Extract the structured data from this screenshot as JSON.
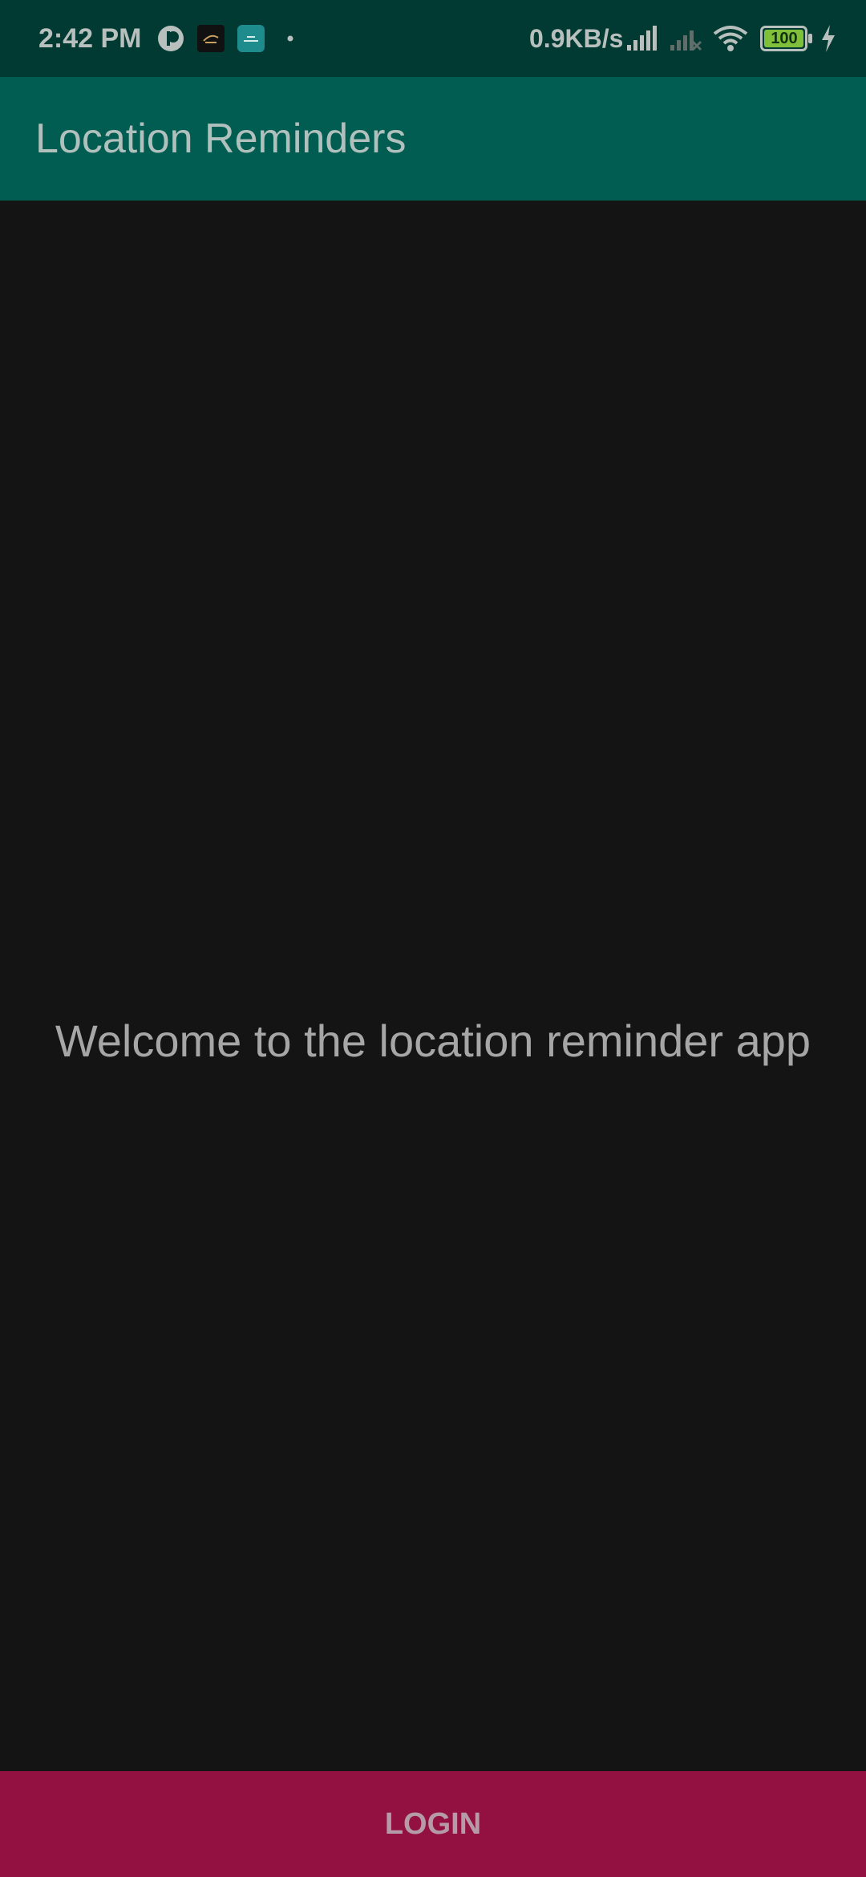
{
  "status_bar": {
    "time": "2:42 PM",
    "network_speed": "0.9KB/s",
    "battery_level": "100",
    "notification_icons": [
      "app-circle-icon",
      "app-dark-icon",
      "app-teal-icon"
    ],
    "indicator_icons": [
      "signal-full-icon",
      "signal-no-sim-icon",
      "wifi-icon",
      "battery-icon",
      "charging-icon"
    ]
  },
  "app_bar": {
    "title": "Location Reminders"
  },
  "main": {
    "welcome_text": "Welcome to the location reminder app"
  },
  "login": {
    "label": "LOGIN"
  },
  "colors": {
    "status_bar_bg": "#013a33",
    "app_bar_bg": "#015c51",
    "content_bg": "#141414",
    "login_bg": "#931140",
    "battery_fill": "#7fbf3a"
  }
}
